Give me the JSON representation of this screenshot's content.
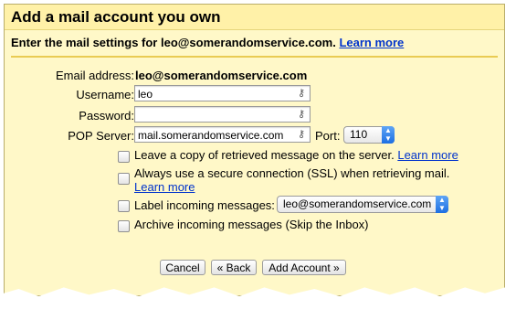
{
  "dialog": {
    "title": "Add a mail account you own",
    "subheader": "Enter the mail settings for leo@somerandomservice.com.",
    "subheader_link": "Learn more"
  },
  "form": {
    "email_label": "Email address:",
    "email_value": "leo@somerandomservice.com",
    "username_label": "Username:",
    "username_value": "leo",
    "password_label": "Password:",
    "password_value": "",
    "pop_label": "POP Server:",
    "pop_value": "mail.somerandomservice.com",
    "port_label": "Port:",
    "port_value": "110"
  },
  "options": {
    "leave_copy": {
      "label": "Leave a copy of retrieved message on the server.",
      "link": "Learn more",
      "checked": false
    },
    "ssl": {
      "label": "Always use a secure connection (SSL) when retrieving mail.",
      "link": "Learn more",
      "checked": false
    },
    "label_incoming": {
      "label": "Label incoming messages:",
      "select_value": "leo@somerandomservice.com",
      "checked": false
    },
    "archive": {
      "label": "Archive incoming messages (Skip the Inbox)",
      "checked": false
    }
  },
  "buttons": {
    "cancel": "Cancel",
    "back": "« Back",
    "add": "Add Account »"
  },
  "icons": {
    "password_helper": "key-icon",
    "select_arrows": "up-down-arrows-icon"
  },
  "colors": {
    "panel": "#fff8c8",
    "title_bar": "#fff1a8",
    "separator": "#e9cb53",
    "link": "#0033cc"
  }
}
